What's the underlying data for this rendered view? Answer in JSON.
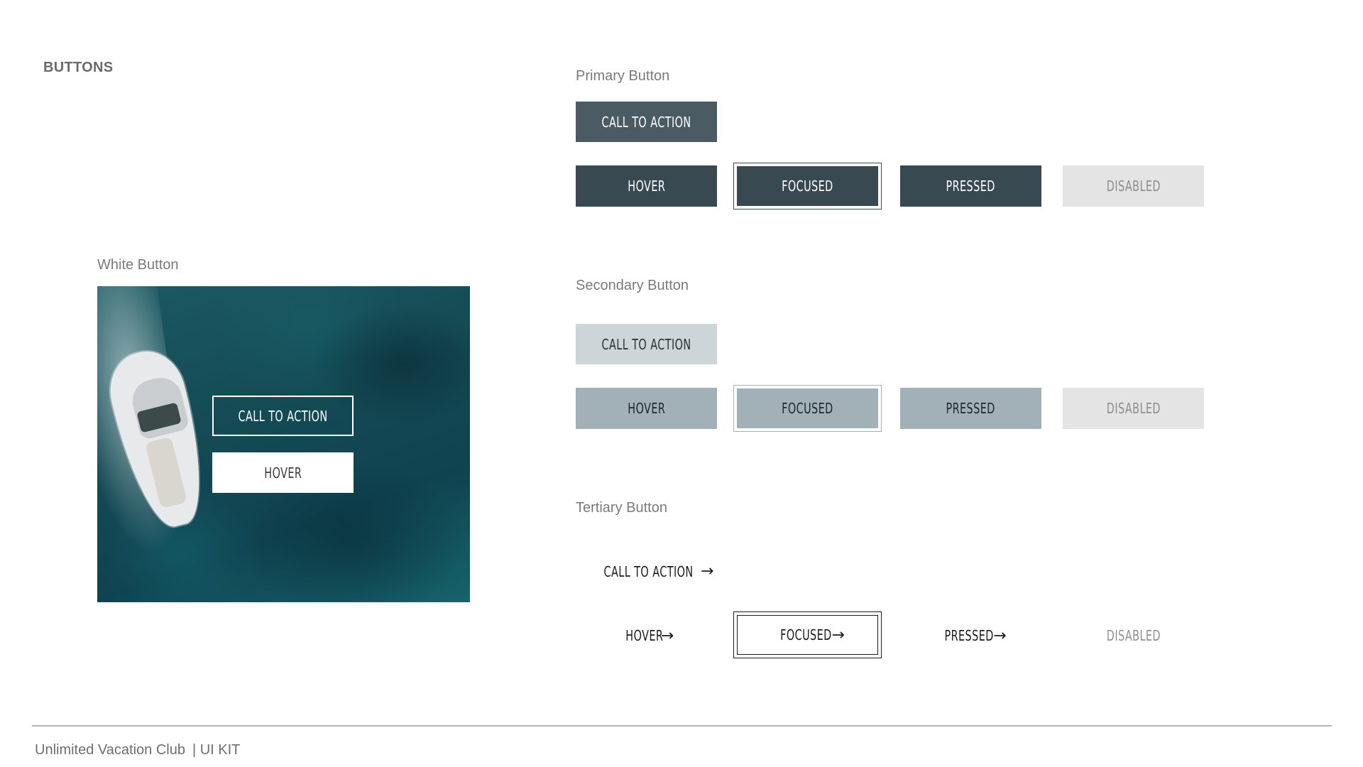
{
  "page": {
    "section_title": "BUTTONS"
  },
  "primary": {
    "label": "Primary Button",
    "cta": "CALL TO ACTION",
    "hover": "HOVER",
    "focused": "FOCUSED",
    "pressed": "PRESSED",
    "disabled": "DISABLED"
  },
  "secondary": {
    "label": "Secondary  Button",
    "cta": "CALL TO ACTION",
    "hover": "HOVER",
    "focused": "FOCUSED",
    "pressed": "PRESSED",
    "disabled": "DISABLED"
  },
  "tertiary": {
    "label": "Tertiary  Button",
    "cta": "CALL TO ACTION",
    "hover": "HOVER",
    "focused": "FOCUSED",
    "pressed": "PRESSED",
    "disabled": "DISABLED",
    "arrow": "→"
  },
  "white": {
    "label": "White Button",
    "cta": "CALL TO ACTION",
    "hover": "HOVER"
  },
  "footer": {
    "brand": "Unlimited Vacation Club",
    "suffix": "| UI KIT"
  },
  "colors": {
    "primary_cta": "#4a5b64",
    "primary_state": "#384952",
    "secondary_cta": "#ccd6d9",
    "secondary_state": "#a2b1b8",
    "disabled": "#e4e4e4"
  }
}
